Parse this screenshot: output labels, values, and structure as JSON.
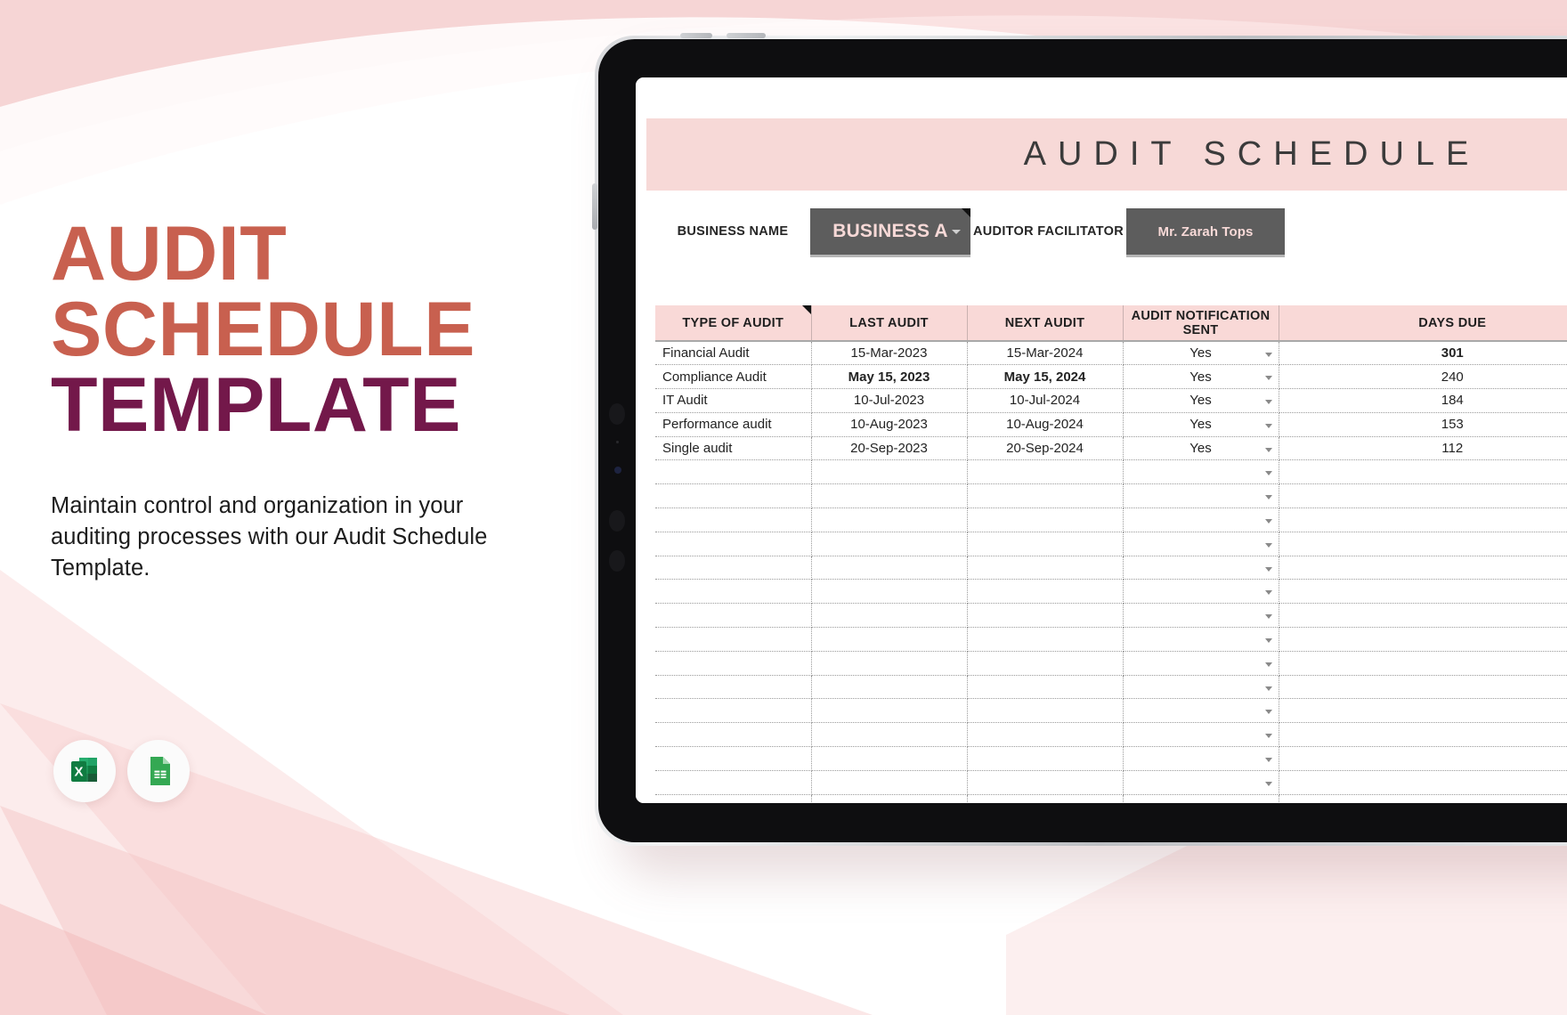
{
  "promo": {
    "headline_line1": "AUDIT",
    "headline_line2": "SCHEDULE",
    "headline_line3": "TEMPLATE",
    "description": "Maintain control and organization in your auditing processes with our Audit Schedule Template.",
    "accent_color": "#C8604F",
    "secondary_color": "#73184A",
    "badges": [
      {
        "name": "microsoft-excel",
        "label": "X"
      },
      {
        "name": "google-sheets",
        "label": ""
      }
    ]
  },
  "spreadsheet": {
    "title": "AUDIT SCHEDULE",
    "title_band_color": "#F7D9D7",
    "meta": {
      "business_name_label": "BUSINESS NAME",
      "business_name_value": "BUSINESS A",
      "auditor_facilitator_label": "AUDITOR FACILITATOR",
      "auditor_facilitator_value": "Mr. Zarah Tops"
    },
    "table": {
      "headers": [
        "TYPE OF AUDIT",
        "LAST AUDIT",
        "NEXT AUDIT",
        "AUDIT NOTIFICATION SENT",
        "DAYS DUE"
      ],
      "rows": [
        {
          "type": "Financial Audit",
          "last": "15-Mar-2023",
          "next": "15-Mar-2024",
          "notification": "Yes",
          "days": "301",
          "bold": false,
          "days_bold": true
        },
        {
          "type": "Compliance Audit",
          "last": "May 15, 2023",
          "next": "May 15, 2024",
          "notification": "Yes",
          "days": "240",
          "bold": true,
          "days_bold": false
        },
        {
          "type": "IT Audit",
          "last": "10-Jul-2023",
          "next": "10-Jul-2024",
          "notification": "Yes",
          "days": "184",
          "bold": false,
          "days_bold": false
        },
        {
          "type": "Performance audit",
          "last": "10-Aug-2023",
          "next": "10-Aug-2024",
          "notification": "Yes",
          "days": "153",
          "bold": false,
          "days_bold": false
        },
        {
          "type": "Single audit",
          "last": "20-Sep-2023",
          "next": "20-Sep-2024",
          "notification": "Yes",
          "days": "112",
          "bold": false,
          "days_bold": false
        }
      ],
      "empty_row_count": 22
    }
  }
}
